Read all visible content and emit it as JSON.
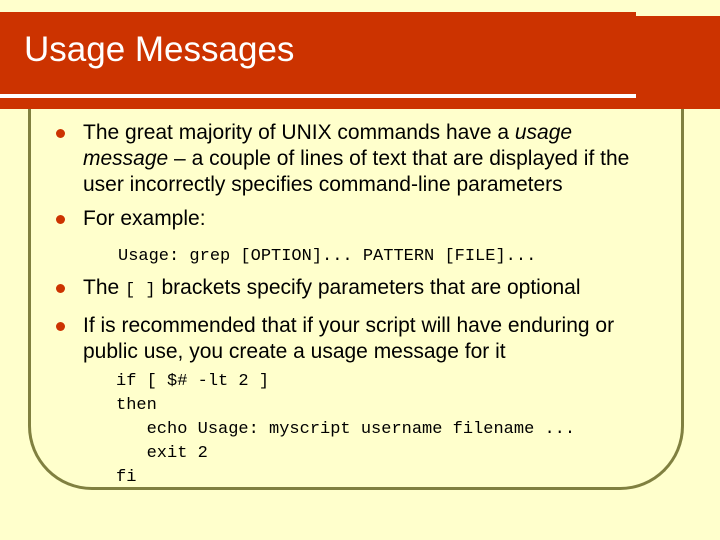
{
  "slide": {
    "title": "Usage Messages",
    "colors": {
      "banner": "#CC3300",
      "background": "#FFFFCC",
      "frame": "#808040",
      "bullet": "#CC3300"
    },
    "bullets": [
      {
        "lead": "The great majority of UNIX commands have a ",
        "em1": "usage message",
        "tail": " – a couple of lines of text that are displayed if the user incorrectly specifies command-line parameters"
      },
      {
        "text": "For example:"
      },
      {
        "pre": "The ",
        "code": "[ ]",
        "post": " brackets specify parameters that are optional"
      },
      {
        "text": "If is recommended that if your script will have enduring or public use, you create a usage message for it"
      }
    ],
    "example_code": "Usage: grep [OPTION]... PATTERN [FILE]...",
    "script_lines": [
      "if [ $# -lt 2 ]",
      "then",
      "   echo Usage: myscript username filename ...",
      "   exit 2",
      "fi"
    ]
  }
}
